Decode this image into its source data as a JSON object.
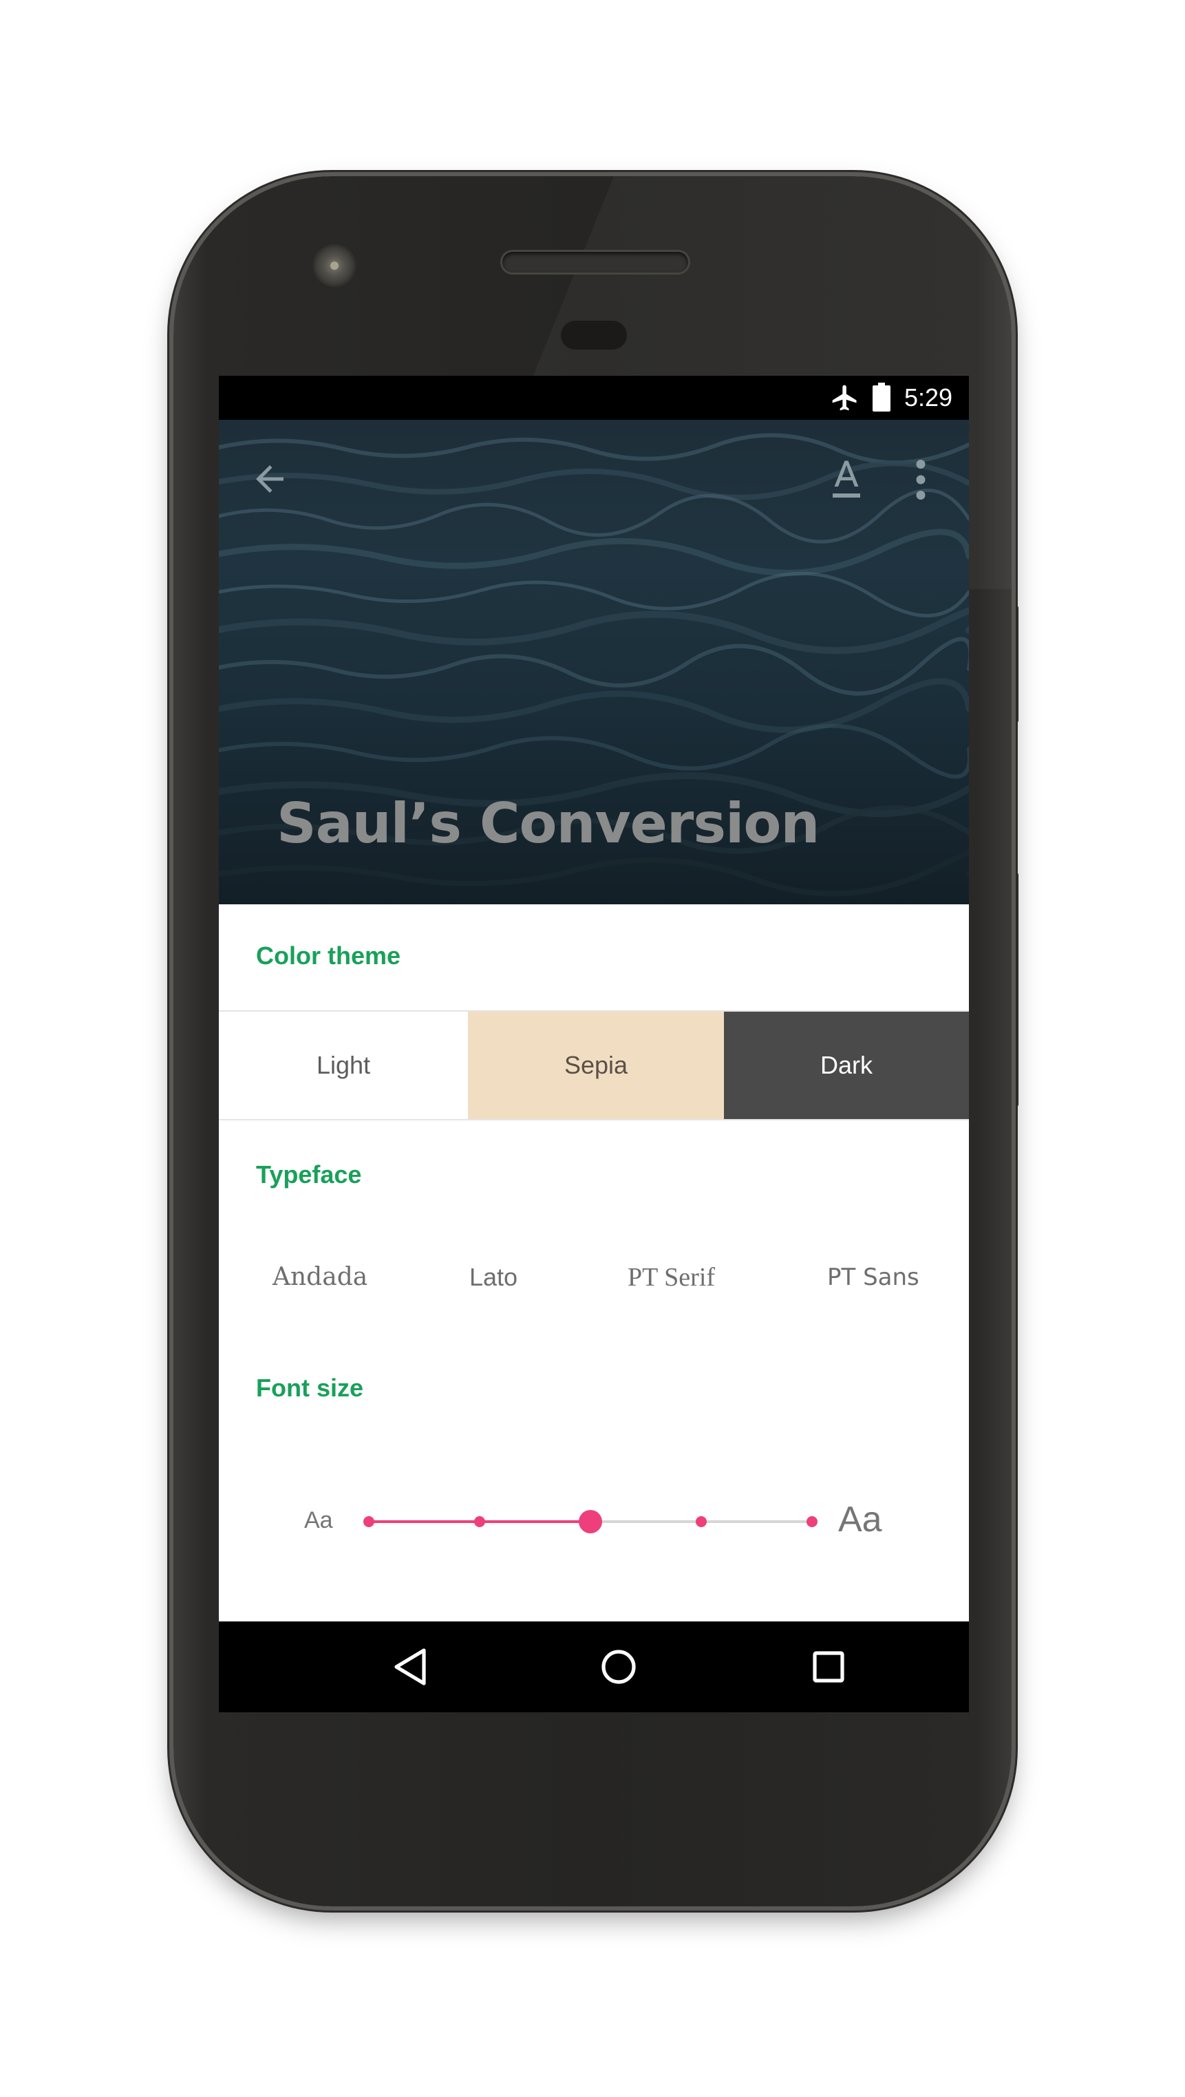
{
  "status_bar": {
    "time": "5:29"
  },
  "article": {
    "title": "Saul’s Conversion"
  },
  "settings": {
    "color_theme": {
      "label": "Color theme",
      "options": [
        "Light",
        "Sepia",
        "Dark"
      ],
      "colors": {
        "Light": "#ffffff",
        "Sepia": "#f1dec2",
        "Dark": "#4a4a4a"
      }
    },
    "typeface": {
      "label": "Typeface",
      "options": [
        "Andada",
        "Lato",
        "PT Serif",
        "PT Sans"
      ]
    },
    "font_size": {
      "label": "Font size",
      "small_label": "Aa",
      "large_label": "Aa",
      "steps": 5,
      "selected_step": 3
    }
  },
  "colors": {
    "accent": "#19a05a",
    "slider": "#ee3f7c"
  },
  "icons": {
    "back": "arrow-back-icon",
    "font": "text-format-icon",
    "more": "more-vert-icon",
    "airplane": "airplane-icon",
    "battery": "battery-icon",
    "nav_back": "triangle-back-icon",
    "nav_home": "circle-home-icon",
    "nav_recent": "square-recents-icon"
  }
}
